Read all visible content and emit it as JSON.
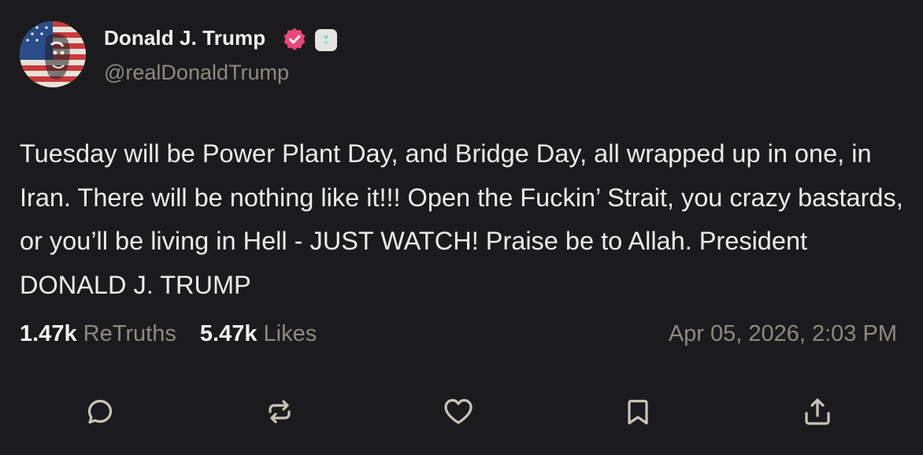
{
  "author": {
    "display_name": "Donald J. Trump",
    "handle": "@realDonaldTrump",
    "verified": true,
    "avatar_icon": "avatar-flag-portrait"
  },
  "post": {
    "text": "Tuesday will be Power Plant Day, and Bridge Day, all wrapped up in one, in Iran. There will be nothing like it!!! Open the Fuckin’ Strait, you crazy bastards, or you’ll be living in Hell - JUST WATCH! Praise be to Allah. President DONALD J. TRUMP"
  },
  "stats": {
    "retruths_count": "1.47k",
    "retruths_label": "ReTruths",
    "likes_count": "5.47k",
    "likes_label": "Likes",
    "timestamp": "Apr 05, 2026, 2:03 PM"
  },
  "actions": [
    {
      "name": "reply",
      "icon": "comment-icon"
    },
    {
      "name": "retruth",
      "icon": "repost-icon"
    },
    {
      "name": "like",
      "icon": "heart-icon"
    },
    {
      "name": "bookmark",
      "icon": "bookmark-icon"
    },
    {
      "name": "share",
      "icon": "share-icon"
    }
  ],
  "colors": {
    "background": "#1b1b1d",
    "text": "#ececec",
    "muted": "#8e8a80",
    "verified": "#e9477a"
  }
}
